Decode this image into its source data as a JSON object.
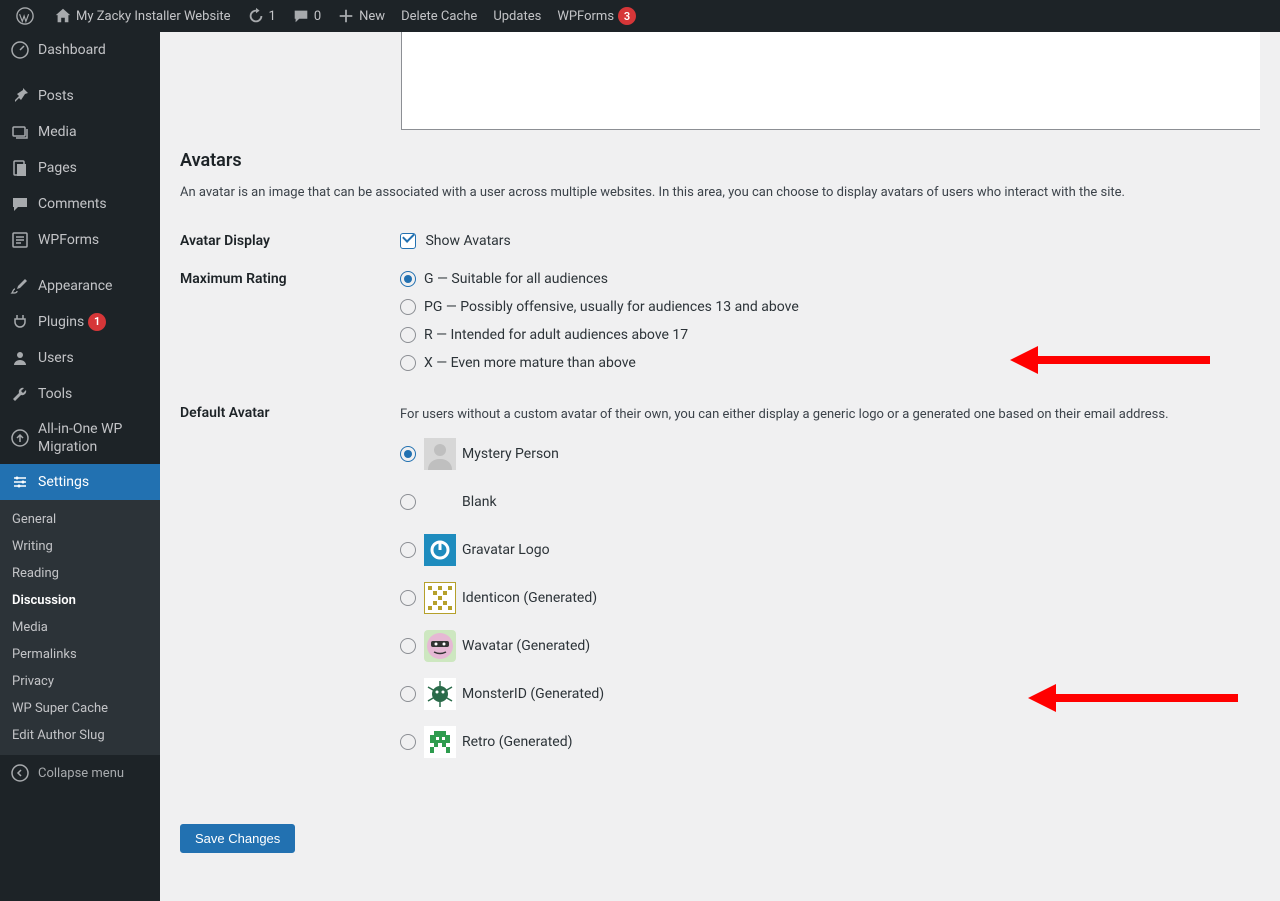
{
  "adminbar": {
    "site_name": "My Zacky Installer Website",
    "updates_count": "1",
    "comments_count": "0",
    "new_label": "New",
    "delete_cache": "Delete Cache",
    "updates": "Updates",
    "wpforms": "WPForms",
    "wpforms_badge": "3"
  },
  "sidebar": {
    "dashboard": "Dashboard",
    "posts": "Posts",
    "media": "Media",
    "pages": "Pages",
    "comments": "Comments",
    "wpforms": "WPForms",
    "appearance": "Appearance",
    "plugins": "Plugins",
    "plugins_badge": "1",
    "users": "Users",
    "tools": "Tools",
    "allinone": "All-in-One WP Migration",
    "settings": "Settings",
    "collapse": "Collapse menu",
    "subs": {
      "general": "General",
      "writing": "Writing",
      "reading": "Reading",
      "discussion": "Discussion",
      "media": "Media",
      "permalinks": "Permalinks",
      "privacy": "Privacy",
      "supercache": "WP Super Cache",
      "editauthor": "Edit Author Slug"
    }
  },
  "section": {
    "heading": "Avatars",
    "description": "An avatar is an image that can be associated with a user across multiple websites. In this area, you can choose to display avatars of users who interact with the site."
  },
  "avatar_display": {
    "label": "Avatar Display",
    "checkbox_label": "Show Avatars",
    "checked": true
  },
  "max_rating": {
    "label": "Maximum Rating",
    "selected": "G",
    "options": [
      {
        "value": "G",
        "label": "G — Suitable for all audiences"
      },
      {
        "value": "PG",
        "label": "PG — Possibly offensive, usually for audiences 13 and above"
      },
      {
        "value": "R",
        "label": "R — Intended for adult audiences above 17"
      },
      {
        "value": "X",
        "label": "X — Even more mature than above"
      }
    ]
  },
  "default_avatar": {
    "label": "Default Avatar",
    "description": "For users without a custom avatar of their own, you can either display a generic logo or a generated one based on their email address.",
    "selected": "mystery",
    "options": [
      {
        "value": "mystery",
        "label": "Mystery Person"
      },
      {
        "value": "blank",
        "label": "Blank"
      },
      {
        "value": "gravatar",
        "label": "Gravatar Logo"
      },
      {
        "value": "identicon",
        "label": "Identicon (Generated)"
      },
      {
        "value": "wavatar",
        "label": "Wavatar (Generated)"
      },
      {
        "value": "monsterid",
        "label": "MonsterID (Generated)"
      },
      {
        "value": "retro",
        "label": "Retro (Generated)"
      }
    ]
  },
  "submit": {
    "label": "Save Changes"
  }
}
